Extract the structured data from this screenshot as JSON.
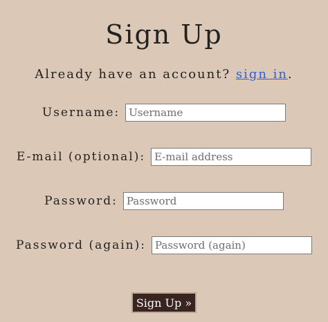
{
  "heading": "Sign Up",
  "signin_prompt": {
    "text": "Already have an account?",
    "link_label": "sign in",
    "suffix": "."
  },
  "fields": {
    "username": {
      "label": "Username:",
      "placeholder": "Username",
      "value": ""
    },
    "email": {
      "label": "E-mail (optional):",
      "placeholder": "E-mail address",
      "value": ""
    },
    "password": {
      "label": "Password:",
      "placeholder": "Password",
      "value": ""
    },
    "password2": {
      "label": "Password (again):",
      "placeholder": "Password (again)",
      "value": ""
    }
  },
  "submit_label": "Sign Up »",
  "colors": {
    "background": "#dcc8b6",
    "link": "#2a62d6",
    "button_bg": "#3a2420"
  }
}
